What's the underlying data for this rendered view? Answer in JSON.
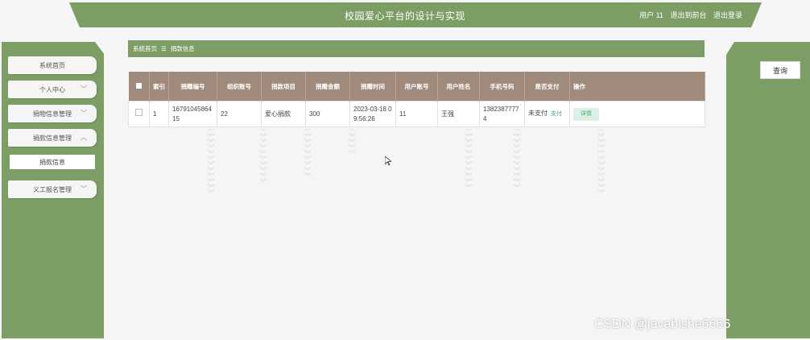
{
  "header": {
    "title": "校园爱心平台的设计与实现",
    "user_label": "用户 11",
    "back_to_front": "退出到前台",
    "logout": "退出登录"
  },
  "sidebar": {
    "items": [
      {
        "label": "系统首页"
      },
      {
        "label": "个人中心"
      },
      {
        "label": "捐物信息管理"
      },
      {
        "label": "捐款信息管理"
      },
      {
        "label": "捐款信息"
      },
      {
        "label": "义工报名管理"
      }
    ]
  },
  "breadcrumb": {
    "home": "系统首页",
    "sep": "☰",
    "current": "捐款信息"
  },
  "right_panel": {
    "search_label": "查询"
  },
  "table": {
    "columns": [
      "索引",
      "捐赠编号",
      "组织账号",
      "捐款项目",
      "捐赠金额",
      "捐赠时间",
      "用户账号",
      "用户姓名",
      "手机号码",
      "是否支付",
      "操作"
    ],
    "rows": [
      {
        "index": "1",
        "donation_no": "1679104586415",
        "org_account": "22",
        "project": "爱心捐款",
        "amount": "300",
        "time": "2023-03-18 09:56:26",
        "user_account": "11",
        "user_name": "王强",
        "phone": "13823877774",
        "pay_status": "未支付",
        "pay_action": "支付",
        "detail_action": "详情"
      }
    ]
  },
  "watermark": "CSDN @javabishe6666",
  "colors": {
    "accent_green": "#7c9e64",
    "table_header": "#a08a7c",
    "link_green": "#4aa36b"
  }
}
